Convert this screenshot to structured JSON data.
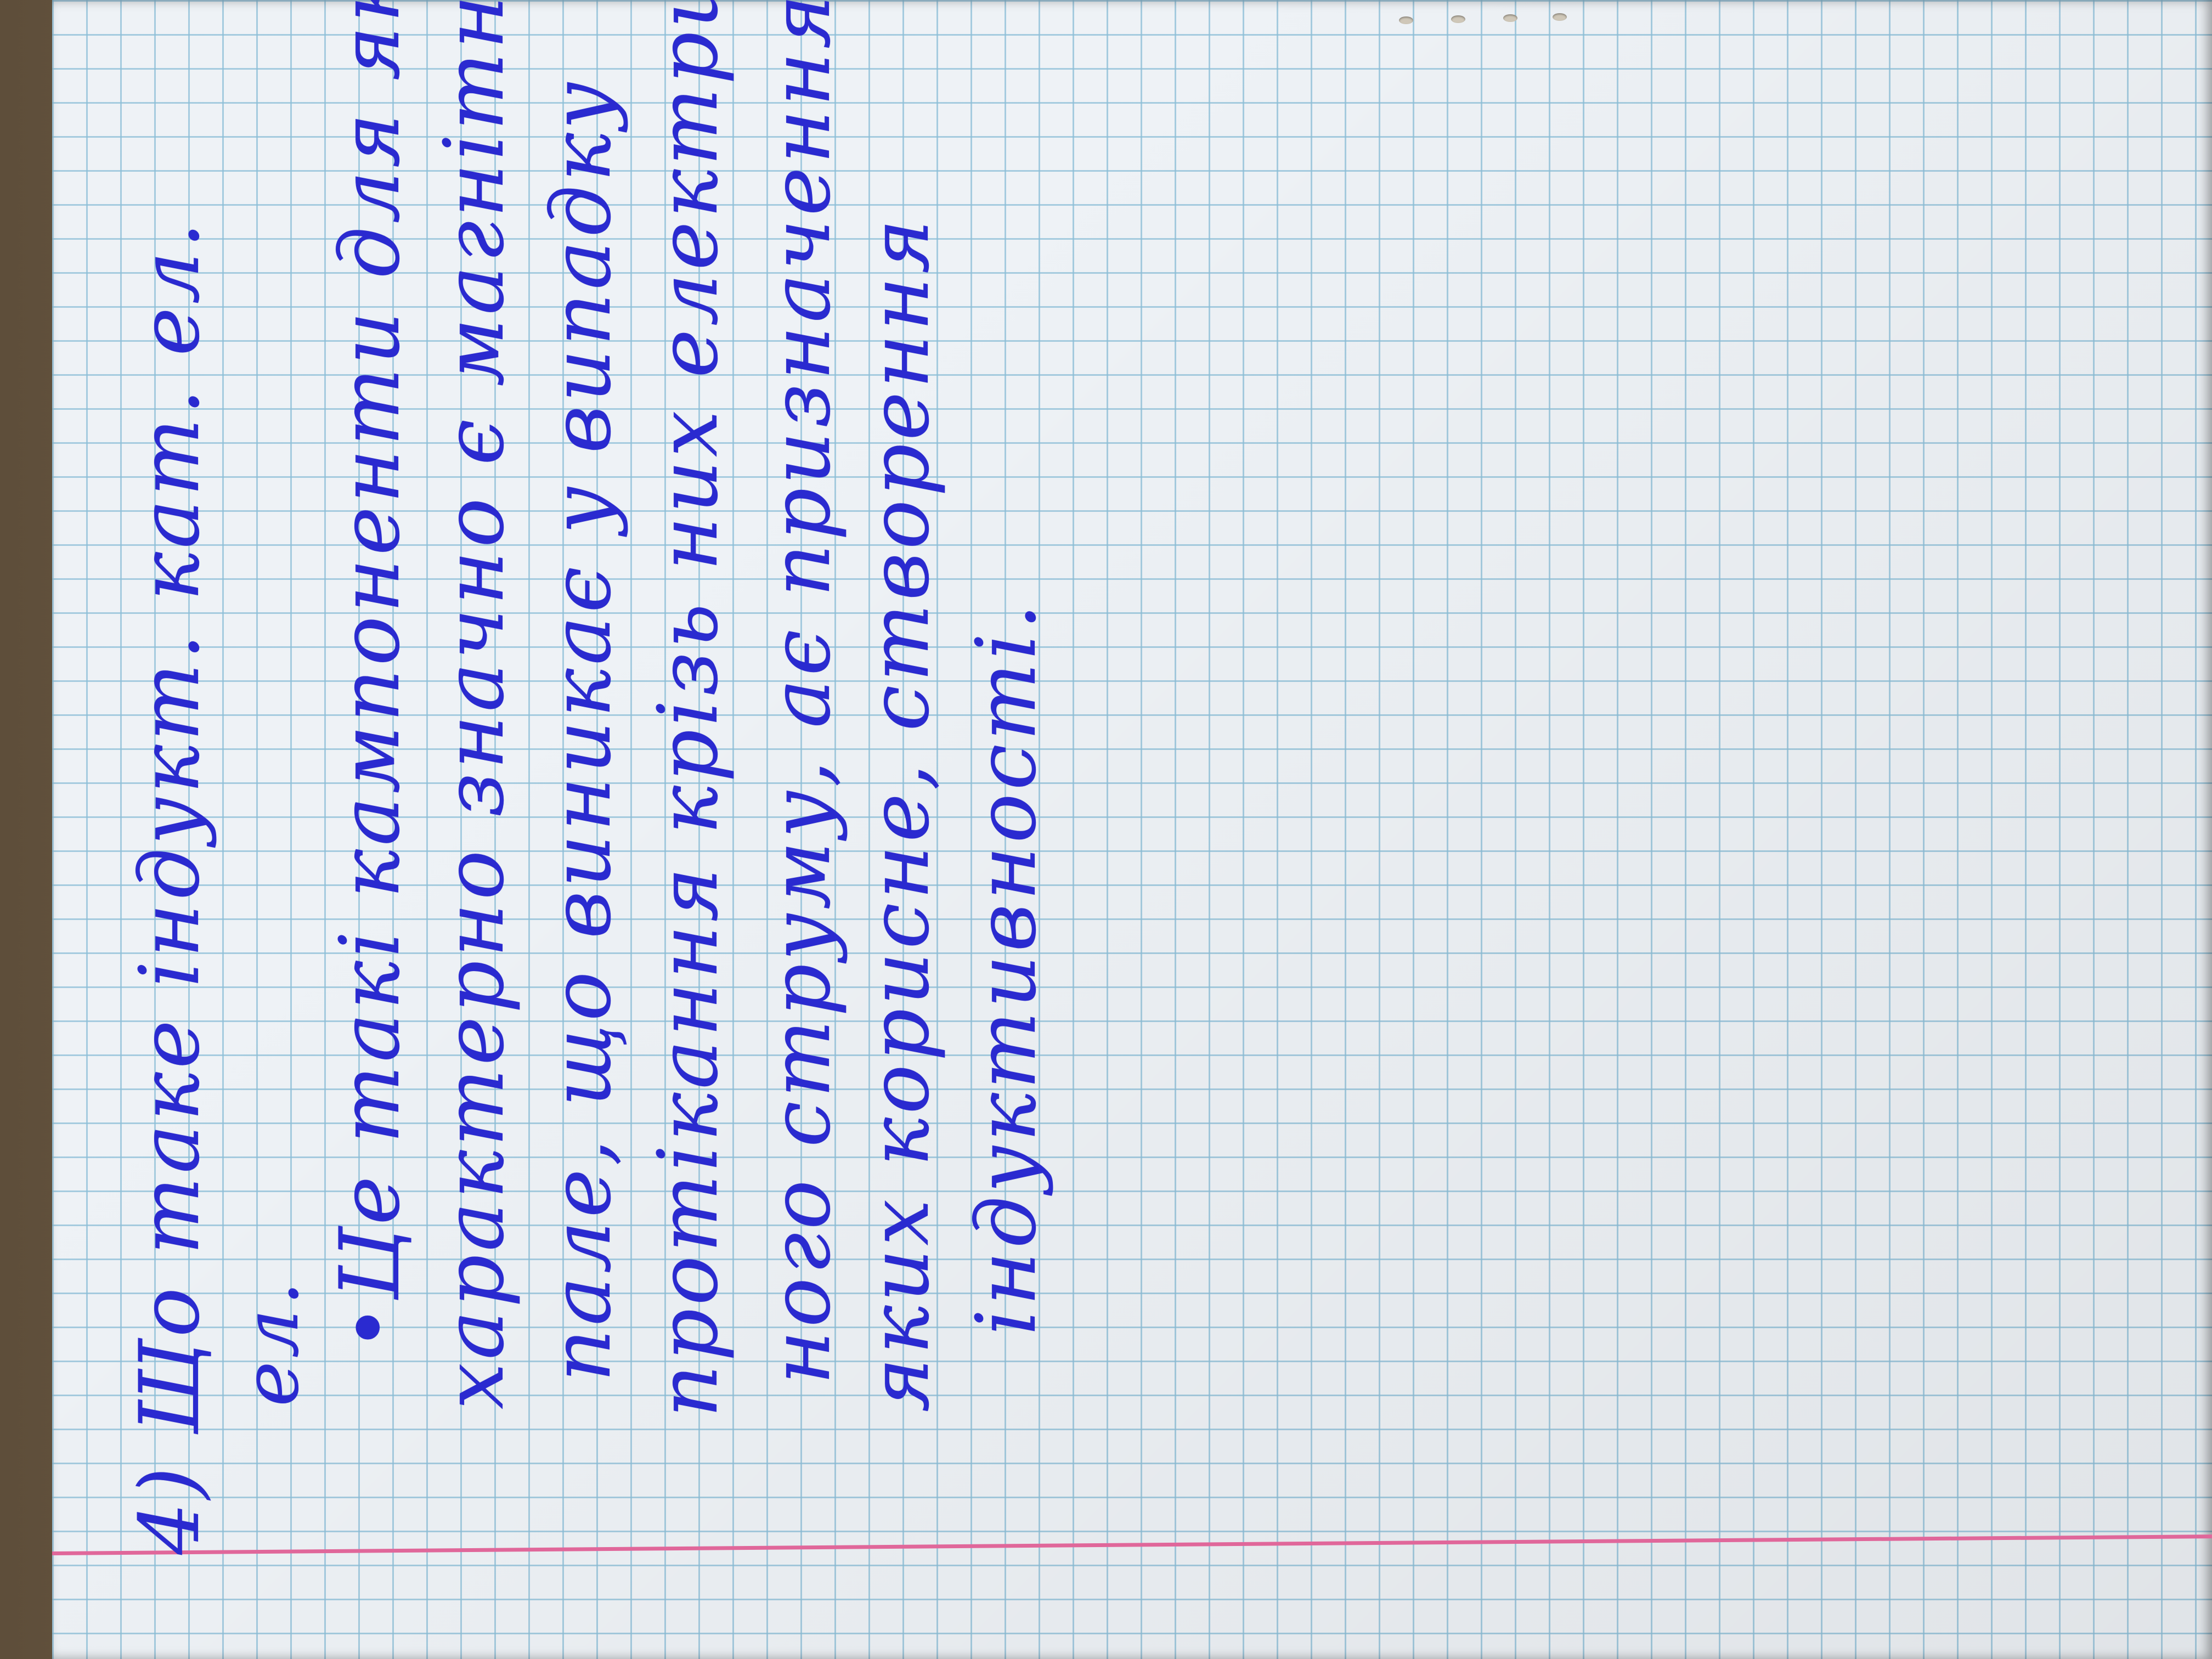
{
  "page": {
    "colors": {
      "ink": "#2a2ad0",
      "margin_line": "#e0679a",
      "grid": "#8cbed7",
      "paper": "#eef2f6"
    },
    "lines": [
      "4) Що таке індукт. кат. ел.",
      "ел.",
      "•Це такі кампоненти для яких",
      "характерно значно є магнітне",
      "пале, що виникає у випадку",
      "протікання крізь них електрич-",
      "ного струму, ає призначення",
      "яких корисне, створення",
      "індуктивності."
    ]
  }
}
